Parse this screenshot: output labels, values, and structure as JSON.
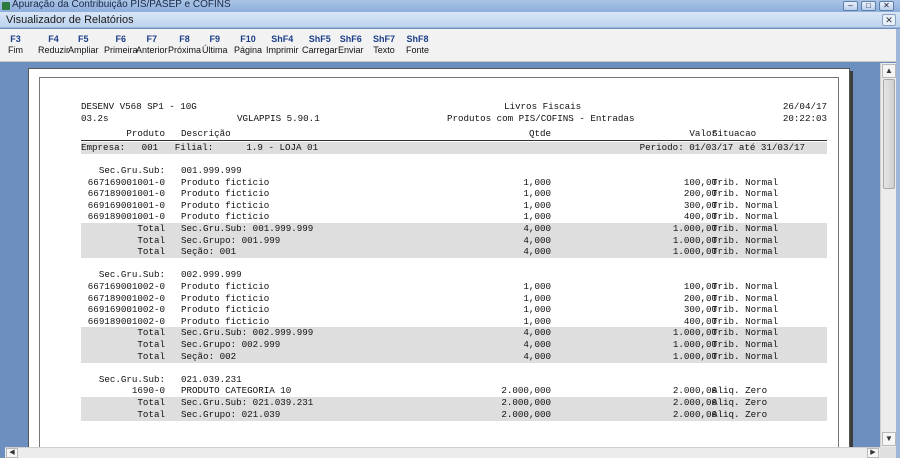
{
  "window": {
    "outer_title": "Apuração da Contribuição PIS/PASEP e COFINS",
    "inner_title": "Visualizador de Relatórios",
    "controls": [
      "–",
      "□",
      "✕"
    ]
  },
  "toolbar": [
    {
      "key": "F3",
      "label": "Fim"
    },
    {
      "key": "F4",
      "label": "Reduzir"
    },
    {
      "key": "F5",
      "label": "Ampliar"
    },
    {
      "key": "F6",
      "label": "Primeira"
    },
    {
      "key": "F7",
      "label": "Anterior"
    },
    {
      "key": "F8",
      "label": "Próxima"
    },
    {
      "key": "F9",
      "label": "Última"
    },
    {
      "key": "F10",
      "label": "Página"
    },
    {
      "key": "ShF4",
      "label": "Imprimir"
    },
    {
      "key": "ShF5",
      "label": "Carregar"
    },
    {
      "key": "ShF6",
      "label": "Enviar"
    },
    {
      "key": "ShF7",
      "label": "Texto"
    },
    {
      "key": "ShF8",
      "label": "Fonte"
    }
  ],
  "report": {
    "h1_left": "DESENV V568 SP1 - 10G",
    "h1_center": "Livros Fiscais",
    "h1_right": "26/04/17",
    "h2_left": "03.2s",
    "h2_mid": "VGLAPPIS 5.90.1",
    "h2_center": "Produtos com PIS/COFINS - Entradas",
    "h2_right": "20:22:03",
    "cols": {
      "produto": "Produto",
      "descricao": "Descrição",
      "qtde": "Qtde",
      "valor": "Valor",
      "situacao": "Situacao"
    },
    "empresa_line": "Empresa:   001   Filial:      1.9 - LOJA 01",
    "periodo": "Periodo: 01/03/17 até 31/03/17",
    "rows": [
      {
        "p": "Sec.Gru.Sub:",
        "d": "001.999.999",
        "q": "",
        "v": "",
        "s": "",
        "shade": false
      },
      {
        "p": "667169001001-0",
        "d": "Produto ficticio",
        "q": "1,000",
        "v": "100,00",
        "s": "Trib. Normal",
        "shade": false
      },
      {
        "p": "667189001001-0",
        "d": "Produto ficticio",
        "q": "1,000",
        "v": "200,00",
        "s": "Trib. Normal",
        "shade": false
      },
      {
        "p": "669169001001-0",
        "d": "Produto ficticio",
        "q": "1,000",
        "v": "300,00",
        "s": "Trib. Normal",
        "shade": false
      },
      {
        "p": "669189001001-0",
        "d": "Produto ficticio",
        "q": "1,000",
        "v": "400,00",
        "s": "Trib. Normal",
        "shade": false
      },
      {
        "p": "Total",
        "d": "Sec.Gru.Sub: 001.999.999",
        "q": "4,000",
        "v": "1.000,00",
        "s": "Trib. Normal",
        "shade": true
      },
      {
        "p": "Total",
        "d": "Sec.Grupo: 001.999",
        "q": "4,000",
        "v": "1.000,00",
        "s": "Trib. Normal",
        "shade": true
      },
      {
        "p": "Total",
        "d": "Seção: 001",
        "q": "4,000",
        "v": "1.000,00",
        "s": "Trib. Normal",
        "shade": true
      },
      {
        "p": "",
        "d": "",
        "q": "",
        "v": "",
        "s": "",
        "shade": false
      },
      {
        "p": "Sec.Gru.Sub:",
        "d": "002.999.999",
        "q": "",
        "v": "",
        "s": "",
        "shade": false
      },
      {
        "p": "667169001002-0",
        "d": "Produto ficticio",
        "q": "1,000",
        "v": "100,00",
        "s": "Trib. Normal",
        "shade": false
      },
      {
        "p": "667189001002-0",
        "d": "Produto ficticio",
        "q": "1,000",
        "v": "200,00",
        "s": "Trib. Normal",
        "shade": false
      },
      {
        "p": "669169001002-0",
        "d": "Produto ficticio",
        "q": "1,000",
        "v": "300,00",
        "s": "Trib. Normal",
        "shade": false
      },
      {
        "p": "669189001002-0",
        "d": "Produto ficticio",
        "q": "1,000",
        "v": "400,00",
        "s": "Trib. Normal",
        "shade": false
      },
      {
        "p": "Total",
        "d": "Sec.Gru.Sub: 002.999.999",
        "q": "4,000",
        "v": "1.000,00",
        "s": "Trib. Normal",
        "shade": true
      },
      {
        "p": "Total",
        "d": "Sec.Grupo: 002.999",
        "q": "4,000",
        "v": "1.000,00",
        "s": "Trib. Normal",
        "shade": true
      },
      {
        "p": "Total",
        "d": "Seção: 002",
        "q": "4,000",
        "v": "1.000,00",
        "s": "Trib. Normal",
        "shade": true
      },
      {
        "p": "",
        "d": "",
        "q": "",
        "v": "",
        "s": "",
        "shade": false
      },
      {
        "p": "Sec.Gru.Sub:",
        "d": "021.039.231",
        "q": "",
        "v": "",
        "s": "",
        "shade": false
      },
      {
        "p": "1690-0",
        "d": "PRODUTO CATEGORIA 10",
        "q": "2.000,000",
        "v": "2.000,00",
        "s": "Aliq. Zero",
        "shade": false
      },
      {
        "p": "Total",
        "d": "Sec.Gru.Sub: 021.039.231",
        "q": "2.000,000",
        "v": "2.000,00",
        "s": "Aliq. Zero",
        "shade": true
      },
      {
        "p": "Total",
        "d": "Sec.Grupo: 021.039",
        "q": "2.000,000",
        "v": "2.000,00",
        "s": "Aliq. Zero",
        "shade": true
      }
    ]
  }
}
